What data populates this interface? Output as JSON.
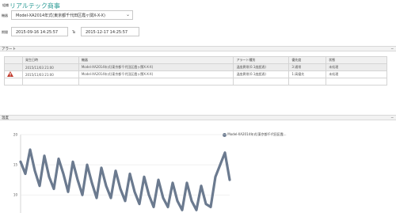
{
  "header": {
    "small_label": "組織",
    "title": "リアルテック商事"
  },
  "device_filter": {
    "label": "機器",
    "selected": "Model-XA2014年式(東京都千代田区霞ヶ関X-X-X)"
  },
  "period": {
    "label": "期間",
    "from": "2015-09-16 14:25:57",
    "separator": "To",
    "to": "2015-12-17 14:25:57"
  },
  "alerts": {
    "section_title": "アラート",
    "columns": [
      "",
      "発生日時",
      "機器",
      "アラート種別",
      "優先度",
      "状態"
    ],
    "rows": [
      {
        "icon": "",
        "time": "2015/11/03 21:00",
        "device": "Model-XA2014年式(東京都千代田区霞ヶ関X-X-X)",
        "type": "温度異常(0.1度超過)",
        "priority": "3:通常",
        "status": "未処理"
      },
      {
        "icon": "warning-icon",
        "time": "2015/11/03 21:00",
        "device": "Model-XA2014年式(東京都千代田区霞ヶ関X-X-X)",
        "type": "温度異常(0.1度超過)",
        "priority": "1:高優先",
        "status": "未処理"
      }
    ]
  },
  "temperature": {
    "section_title": "温度",
    "legend": "Model-XA2014年式(東京都千代田区霞...",
    "series_color": "#6b7a8f"
  },
  "chart_data": {
    "type": "line",
    "yticks": [
      "20",
      "15",
      "10"
    ],
    "ylim": [
      7,
      20
    ],
    "series": [
      {
        "name": "Model-XA2014年式(東京都千代田区霞...",
        "values": [
          15.5,
          13.5,
          17.5,
          14,
          11.5,
          16.5,
          13,
          11,
          16,
          13.5,
          10.5,
          15.5,
          12.5,
          10,
          15,
          12,
          9.5,
          14.5,
          11.5,
          9.5,
          14,
          11,
          9,
          13.5,
          10.5,
          8.5,
          13,
          10,
          8,
          12.5,
          9.5,
          8,
          12,
          9,
          7.5,
          12,
          9,
          7.5,
          11.5,
          8.5,
          8,
          13,
          15,
          17,
          12.5
        ]
      }
    ]
  }
}
